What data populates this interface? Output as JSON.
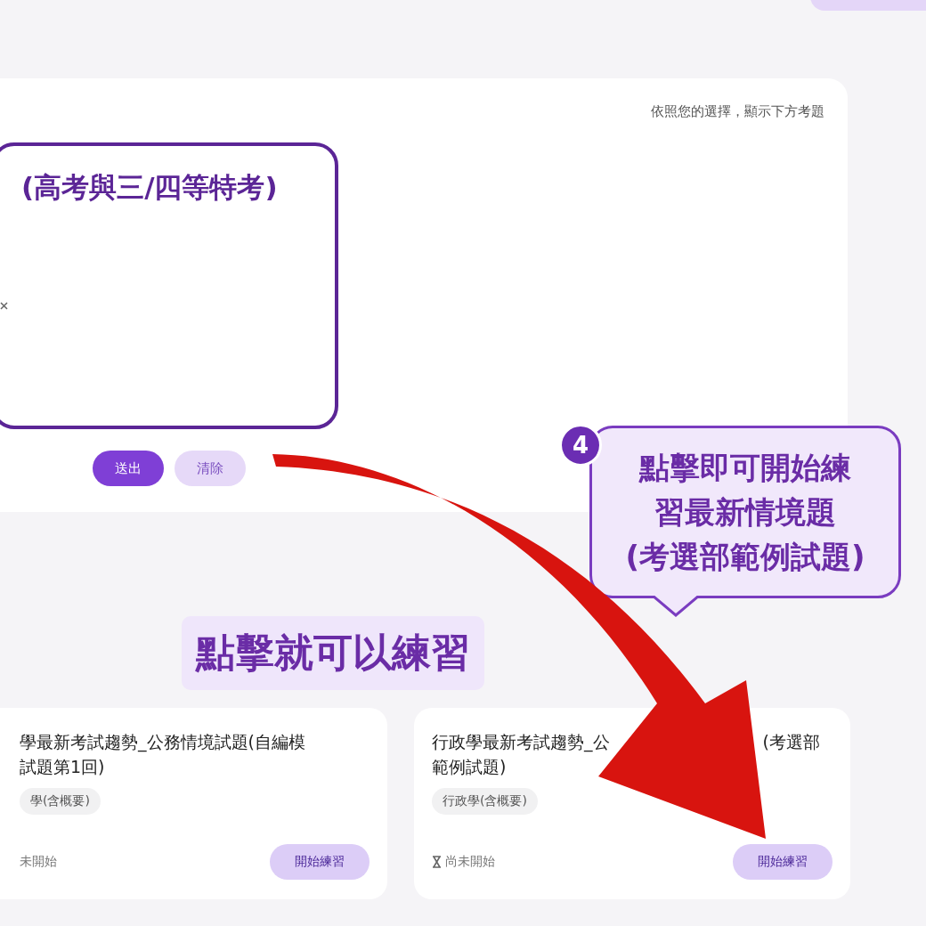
{
  "filter_panel": {
    "hint": "依照您的選擇，顯示下方考題",
    "highlighted_heading": "(高考與三/四等特考)",
    "buttons": [
      {
        "label": "送出",
        "kind": "primary"
      },
      {
        "label": "清除",
        "kind": "secondary"
      }
    ]
  },
  "tip": {
    "step": "4",
    "lines": [
      "點擊即可開始練",
      "習最新情境題",
      "(考選部範例試題)"
    ]
  },
  "banner": {
    "text": "點擊就可以練習"
  },
  "exam_cards": [
    {
      "title_lines": [
        [
          "學最新考試趨勢_公務情境試題(自編模"
        ],
        [
          "試題第1回)"
        ]
      ],
      "tag": "學(含概要)",
      "status": "未開始",
      "button": "開始練習"
    },
    {
      "title_lines": [
        [
          "行政學最新考試趨勢_公",
          "(考選部"
        ],
        [
          "範例試題)"
        ]
      ],
      "tag": "行政學(含概要)",
      "status": "尚未開始",
      "button": "開始練習"
    }
  ]
}
